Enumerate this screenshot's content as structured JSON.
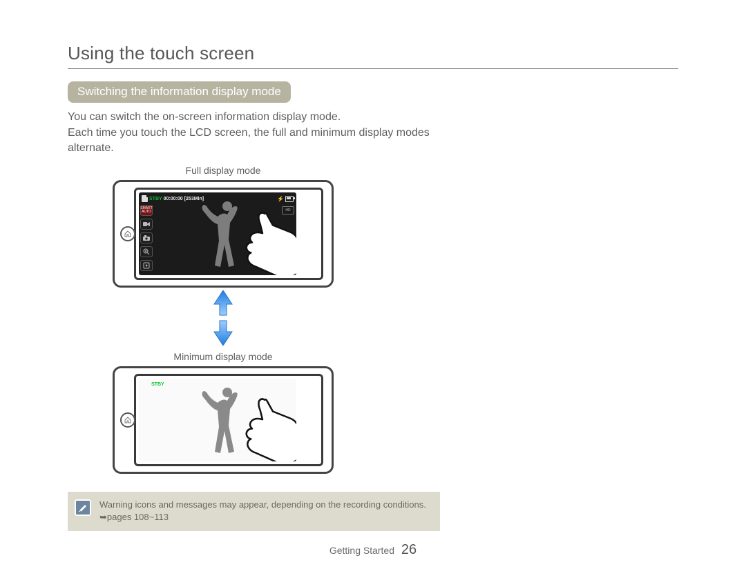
{
  "page": {
    "title": "Using the touch screen",
    "section_label": "Switching the information display mode",
    "body": "You can switch the on-screen information display mode.\nEach time you touch the LCD screen, the full and minimum display modes alternate.",
    "captions": {
      "full": "Full display mode",
      "minimum": "Minimum display mode"
    },
    "full_display": {
      "stby": "STBY",
      "time": "00:00:00",
      "remaining": "[253Min]",
      "smart_auto": "SMART AUTO"
    },
    "min_display": {
      "stby": "STBY"
    },
    "note": "Warning icons and messages may appear, depending on the recording conditions. ➥pages 108~113",
    "footer_section": "Getting Started",
    "page_number": "26"
  }
}
